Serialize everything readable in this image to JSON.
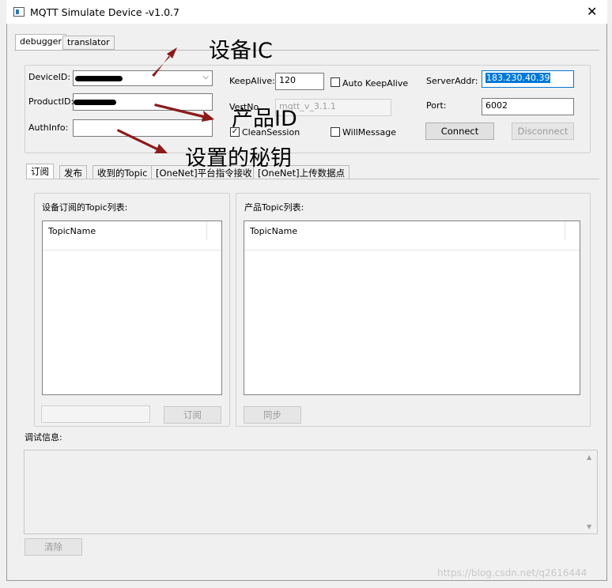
{
  "window": {
    "title": "MQTT Simulate Device  -v1.0.7",
    "close_glyph": "✕"
  },
  "main_tabs": [
    {
      "label": "debugger",
      "active": true
    },
    {
      "label": "translator",
      "active": false
    }
  ],
  "connection": {
    "device_id": {
      "label": "DeviceID:",
      "value": ""
    },
    "product_id": {
      "label": "ProductID:",
      "value": ""
    },
    "auth_info": {
      "label": "AuthInfo:",
      "value": ""
    },
    "keepalive": {
      "label": "KeepAlive:",
      "value": "120"
    },
    "auto_keepalive": {
      "label": "Auto KeepAlive",
      "checked": false
    },
    "version": {
      "label": "VertNo",
      "value": "mqtt_v_3.1.1"
    },
    "clean_session": {
      "label": "CleanSession",
      "checked": true
    },
    "will_message": {
      "label": "WillMessage",
      "checked": false
    },
    "server_addr": {
      "label": "ServerAddr:",
      "value": "183.230.40.39"
    },
    "port": {
      "label": "Port:",
      "value": "6002"
    },
    "connect_label": "Connect",
    "disconnect_label": "Disconnect"
  },
  "sub_tabs": [
    {
      "label": "订阅",
      "active": true
    },
    {
      "label": "发布",
      "active": false
    },
    {
      "label": "收到的Topic",
      "active": false
    },
    {
      "label": "[OneNet]平台指令接收",
      "active": false
    },
    {
      "label": "[OneNet]上传数据点",
      "active": false
    }
  ],
  "device_topics": {
    "title": "设备订阅的Topic列表:",
    "column": "TopicName",
    "input_value": "",
    "subscribe_label": "订阅"
  },
  "product_topics": {
    "title": "产品Topic列表:",
    "column": "TopicName",
    "sync_label": "同步"
  },
  "debug": {
    "title": "调试信息:",
    "text": "",
    "clear_label": "清除",
    "scroll_up": "▲",
    "scroll_down": "▼"
  },
  "annotations": {
    "device_ic": "设备IC",
    "product_id": "产品ID",
    "secret_key": "设置的秘钥"
  },
  "watermark": "https://blog.csdn.net/q2616444",
  "colors": {
    "arrow": "#8b1a1a",
    "selection": "#0078d7"
  }
}
